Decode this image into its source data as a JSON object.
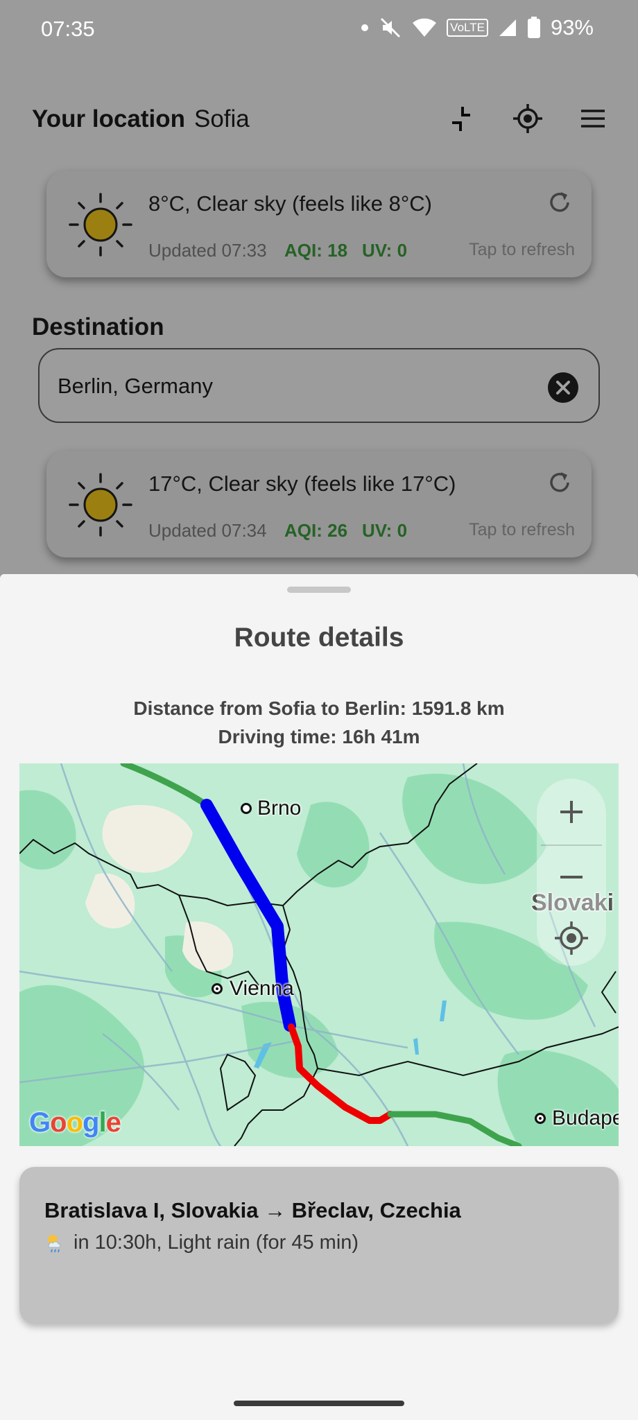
{
  "status_bar": {
    "time": "07:35",
    "network_label": "VoLTE",
    "battery": "93%",
    "icons": [
      "notification-dot-icon",
      "mute-icon",
      "wifi-icon",
      "volte-icon",
      "signal-icon",
      "battery-icon"
    ]
  },
  "header": {
    "label": "Your location",
    "city": "Sofia",
    "icons": [
      "collapse-icon",
      "locate-icon",
      "menu-icon"
    ]
  },
  "origin_weather": {
    "condition": "8°C, Clear sky (feels like 8°C)",
    "updated": "Updated 07:33",
    "aqi": "AQI: 18",
    "uv": "UV: 0",
    "refresh_hint": "Tap to refresh"
  },
  "destination": {
    "label": "Destination",
    "value": "Berlin, Germany"
  },
  "destination_weather": {
    "condition": "17°C, Clear sky (feels like 17°C)",
    "updated": "Updated 07:34",
    "aqi": "AQI: 26",
    "uv": "UV: 0",
    "refresh_hint": "Tap to refresh"
  },
  "sheet": {
    "title": "Route details",
    "distance": "Distance from Sofia to Berlin: 1591.8 km",
    "driving_time": "Driving time: 16h 41m"
  },
  "map": {
    "labels": {
      "brno": "Brno",
      "vienna": "Vienna",
      "slovakia": "Slovaki",
      "budapest": "Budape"
    },
    "attribution": [
      "G",
      "o",
      "o",
      "g",
      "l",
      "e"
    ],
    "colors": {
      "route_blue": "#0000ee",
      "route_red": "#ee0000",
      "route_green": "#3fa34d",
      "land": "#bfecd3"
    }
  },
  "segment": {
    "route": "Bratislava I, Slovakia → Břeclav, Czechia",
    "forecast": "in 10:30h, Light rain (for 45 min)",
    "forecast_icon": "sun-behind-rain-cloud-icon"
  }
}
